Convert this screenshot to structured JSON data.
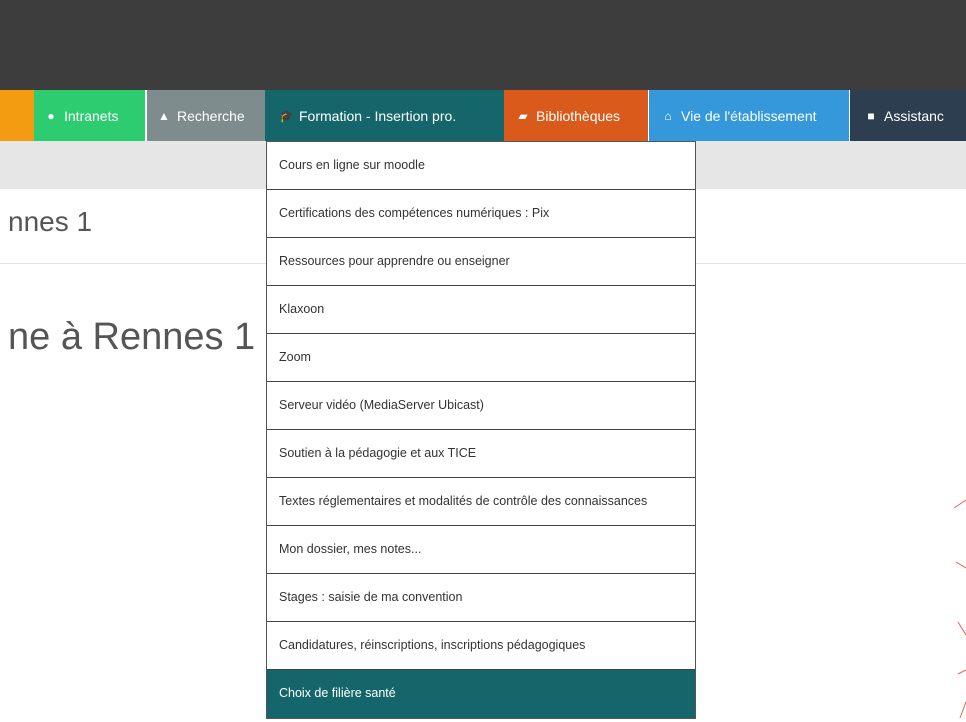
{
  "nav": {
    "items": [
      {
        "label": "Intranets",
        "icon": "globe-icon"
      },
      {
        "label": "Recherche",
        "icon": "flask-icon"
      },
      {
        "label": "Formation - Insertion pro.",
        "icon": "graduation-cap-icon"
      },
      {
        "label": "Bibliothèques",
        "icon": "book-icon"
      },
      {
        "label": "Vie de l'établissement",
        "icon": "bank-icon"
      },
      {
        "label": "Assistanc",
        "icon": "ambulance-icon"
      }
    ],
    "colors": {
      "orange": "#f39c12",
      "intranets": "#2ecc71",
      "recherche": "#7f8c8d",
      "formation": "#14666b",
      "bibliotheques": "#d95a1b",
      "vie": "#3498db",
      "assistance": "#2c3e50"
    }
  },
  "site_title": "nnes 1",
  "page_heading": "ne à Rennes 1",
  "dropdown": {
    "items": [
      "Cours en ligne sur moodle",
      "Certifications des compétences numériques : Pix",
      "Ressources pour apprendre ou enseigner",
      "Klaxoon",
      "Zoom",
      "Serveur vidéo (MediaServer Ubicast)",
      "Soutien à la pédagogie et aux TICE",
      "Textes réglementaires et modalités de contrôle des connaissances",
      "Mon dossier, mes notes...",
      "Stages : saisie de ma convention",
      "Candidatures, réinscriptions, inscriptions pédagogiques",
      "Choix de filière santé"
    ],
    "active_item": "Choix de filière santé"
  }
}
